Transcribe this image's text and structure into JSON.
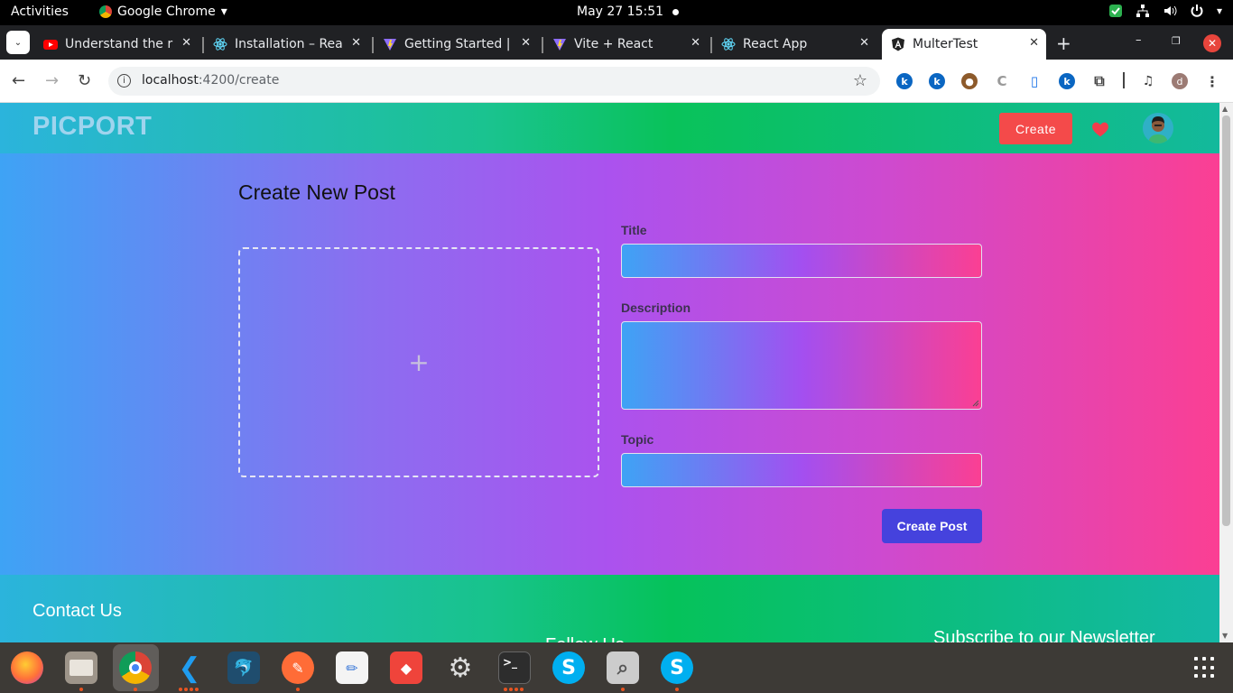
{
  "system_bar": {
    "activities": "Activities",
    "app_name": "Google Chrome",
    "clock": "May 27  15:51"
  },
  "browser": {
    "tabs": [
      {
        "title": "Understand the r",
        "icon": "youtube-icon"
      },
      {
        "title": "Installation – Rea",
        "icon": "react-icon"
      },
      {
        "title": "Getting Started |",
        "icon": "vite-icon"
      },
      {
        "title": "Vite + React",
        "icon": "vite-icon"
      },
      {
        "title": "React App",
        "icon": "react-icon"
      },
      {
        "title": "MulterTest",
        "icon": "angular-icon",
        "active": true
      }
    ],
    "url_host": "localhost",
    "url_path": ":4200/create",
    "profile_initial": "d"
  },
  "page": {
    "brand": "PICPORT",
    "nav_create": "Create",
    "title": "Create New Post",
    "upload_placeholder": "+",
    "fields": {
      "title_label": "Title",
      "description_label": "Description",
      "topic_label": "Topic"
    },
    "submit": "Create Post",
    "footer": {
      "contact": "Contact Us",
      "follow": "Follow Us",
      "newsletter": "Subscribe to our Newsletter"
    }
  },
  "colors": {
    "navbar_start": "#2bb4dc",
    "navbar_mid": "#09c25a",
    "hero_start": "#3ea3f5",
    "hero_mid": "#ab52ee",
    "hero_end": "#fb3f93",
    "create_button": "#f44a4a",
    "submit_button": "#4542dd"
  },
  "dock": [
    "firefox",
    "files",
    "chrome",
    "vscode",
    "mysql-workbench",
    "postman",
    "text-editor",
    "anydesk",
    "settings",
    "terminal",
    "skype",
    "image-viewer",
    "skype"
  ]
}
